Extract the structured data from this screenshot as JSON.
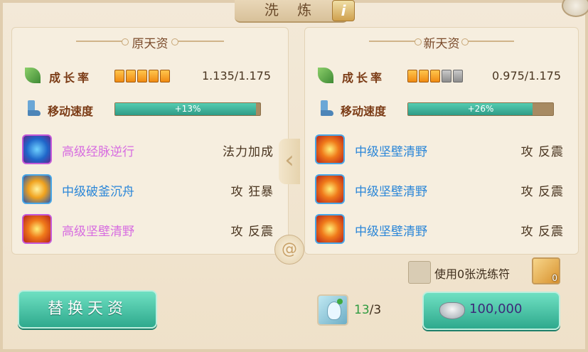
{
  "title": "洗 炼",
  "info_icon": "i",
  "left": {
    "heading": "原天资",
    "growth": {
      "label": "成长率",
      "value": "1.135/1.175",
      "pips_on": 5,
      "pips_total": 5
    },
    "speed": {
      "label": "移动速度",
      "bar_text": "+13%",
      "bar_fraction": 0.97
    },
    "skills": [
      {
        "name": "高级经脉逆行",
        "tag": "法力加成",
        "color": "purple",
        "icon": "meridian-skill-icon"
      },
      {
        "name": "中级破釜沉舟",
        "tag": "攻 狂暴",
        "color": "blue",
        "icon": "rampage-skill-icon"
      },
      {
        "name": "高级坚壁清野",
        "tag": "攻 反震",
        "color": "purple",
        "icon": "fire-shield-skill-icon"
      }
    ]
  },
  "right": {
    "heading": "新天资",
    "growth": {
      "label": "成长率",
      "value": "0.975/1.175",
      "pips_on": 3,
      "pips_total": 5
    },
    "speed": {
      "label": "移动速度",
      "bar_text": "+26%",
      "bar_fraction": 0.86
    },
    "skills": [
      {
        "name": "中级坚壁清野",
        "tag": "攻 反震",
        "color": "blue",
        "icon": "fire-shield-skill-icon"
      },
      {
        "name": "中级坚壁清野",
        "tag": "攻 反震",
        "color": "blue",
        "icon": "fire-shield-skill-icon"
      },
      {
        "name": "中级坚壁清野",
        "tag": "攻 反震",
        "color": "blue",
        "icon": "fire-shield-skill-icon"
      }
    ]
  },
  "talisman": {
    "label": "使用0张洗练符",
    "count": "0"
  },
  "replace_button": "替换天资",
  "material": {
    "have": "13",
    "need": "/3"
  },
  "cost": {
    "value": "100,000",
    "icon": "silver-ingot-icon"
  },
  "colors": {
    "accent_green": "#2ea98d",
    "skill_purple": "#d76ce0",
    "skill_blue": "#2a86d8"
  }
}
